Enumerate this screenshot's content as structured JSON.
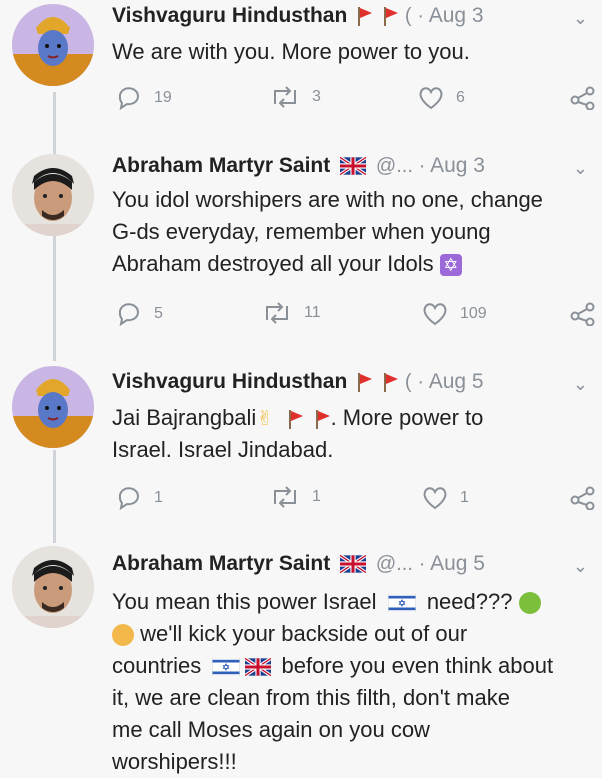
{
  "tweets": [
    {
      "name": "Vishvaguru Hindusthan",
      "handle": "(",
      "sep": "·",
      "date": "Aug 3",
      "text_lines": [
        "We are with you. More power to you."
      ],
      "replies": "19",
      "retweets": "3",
      "likes": "6"
    },
    {
      "name": "Abraham Martyr Saint",
      "handle": "@...",
      "sep": "·",
      "date": "Aug 3",
      "text_lines": [
        "You idol worshipers are with no one, change",
        "G-ds everyday, remember when young",
        "Abraham destroyed all your Idols"
      ],
      "replies": "5",
      "retweets": "11",
      "likes": "109"
    },
    {
      "name": "Vishvaguru Hindusthan",
      "handle": "(",
      "sep": "·",
      "date": "Aug 5",
      "text_line1_a": "Jai Bajrangbali",
      "text_line1_b": ". More power to",
      "text_line2": "Israel.  Israel Jindabad.",
      "replies": "1",
      "retweets": "1",
      "likes": "1"
    },
    {
      "name": "Abraham Martyr Saint",
      "handle": "@...",
      "sep": "·",
      "date": "Aug 5",
      "l1_a": "You mean this power Israel",
      "l1_b": "need???",
      "l2": "we'll kick your backside out of our",
      "l3_a": "countries",
      "l3_b": "before you even think about",
      "l4": "it, we are clean from this filth, don't make",
      "l5": "me call Moses again on you cow",
      "l6": "worshipers!!!"
    }
  ],
  "icons": [
    "reply-icon",
    "retweet-icon",
    "like-icon",
    "share-icon",
    "chevron-down-icon"
  ],
  "colors": {
    "muted": "#8a9098",
    "flag_red": "#e0302c",
    "uk_blue": "#1c3f94",
    "il_blue": "#2f5fb8"
  }
}
